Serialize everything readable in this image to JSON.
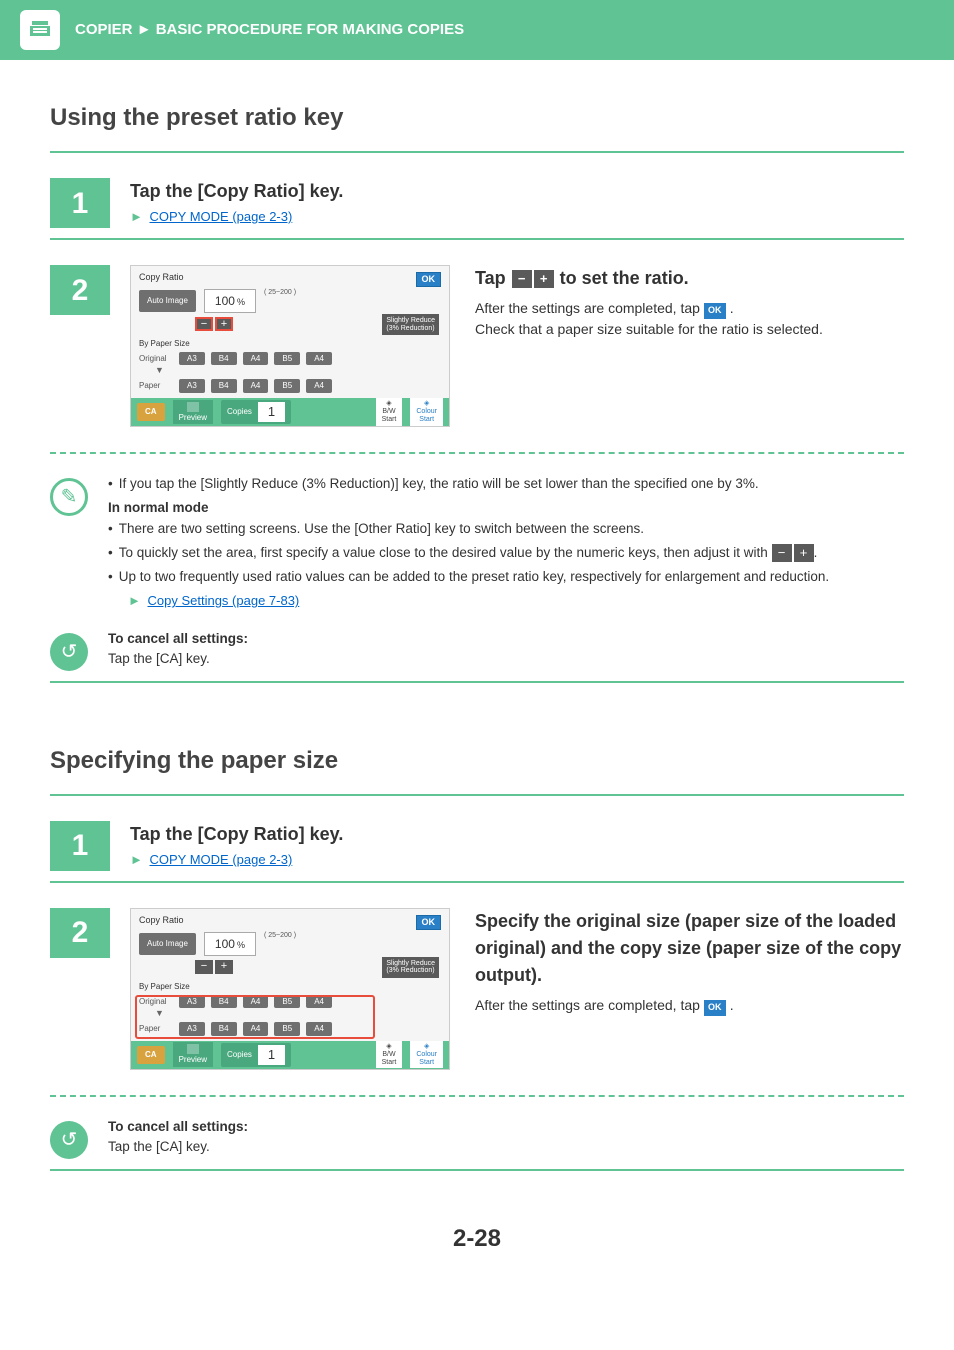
{
  "breadcrumb": {
    "section": "COPIER",
    "page": "BASIC PROCEDURE FOR MAKING COPIES"
  },
  "section1": {
    "title": "Using the preset ratio key",
    "step1": {
      "num": "1",
      "heading": "Tap the [Copy Ratio] key.",
      "link": "COPY MODE (page 2-3)"
    },
    "step2": {
      "num": "2",
      "panel": {
        "title": "Copy Ratio",
        "ok": "OK",
        "auto_image": "Auto Image",
        "ratio_value": "100",
        "ratio_unit": "%",
        "ratio_range": "( 25~200 )",
        "slightly_reduce_l1": "Slightly Reduce",
        "slightly_reduce_l2": "(3% Reduction)",
        "by_paper_size": "By Paper Size",
        "original_label": "Original",
        "paper_label": "Paper",
        "sizes": [
          "A3",
          "B4",
          "A4",
          "B5",
          "A4"
        ],
        "ca": "CA",
        "preview": "Preview",
        "copies_label": "Copies",
        "copies_value": "1",
        "bw_start": "B/W\nStart",
        "colour_start": "Colour\nStart"
      },
      "right": {
        "heading_pre": "Tap",
        "heading_post": "to set the ratio.",
        "line1_pre": "After the settings are completed, tap",
        "line1_post": ".",
        "line2": "Check that a paper size suitable for the ratio is selected."
      }
    },
    "notes": {
      "bullet1": "If you tap the [Slightly Reduce (3% Reduction)] key, the ratio will be set lower than the specified one by 3%.",
      "normal_mode": "In normal mode",
      "bullet2": "There are two setting screens. Use the [Other Ratio] key to switch between the screens.",
      "bullet3_pre": "To quickly set the area, first specify a value close to the desired value by the numeric keys, then adjust it with",
      "bullet3_post": ".",
      "bullet4": "Up to two frequently used ratio values can be added to the preset ratio key, respectively for enlargement and reduction.",
      "settings_link": "Copy Settings (page 7-83)"
    },
    "cancel": {
      "heading": "To cancel all settings:",
      "body": "Tap the [CA] key."
    }
  },
  "section2": {
    "title": "Specifying the paper size",
    "step1": {
      "num": "1",
      "heading": "Tap the [Copy Ratio] key.",
      "link": "COPY MODE (page 2-3)"
    },
    "step2": {
      "num": "2",
      "right": {
        "heading": "Specify the original size (paper size of the loaded original) and the copy size (paper size of the copy output).",
        "line1_pre": "After the settings are completed, tap",
        "line1_post": "."
      }
    },
    "cancel": {
      "heading": "To cancel all settings:",
      "body": "Tap the [CA] key."
    }
  },
  "page_number": "2-28"
}
